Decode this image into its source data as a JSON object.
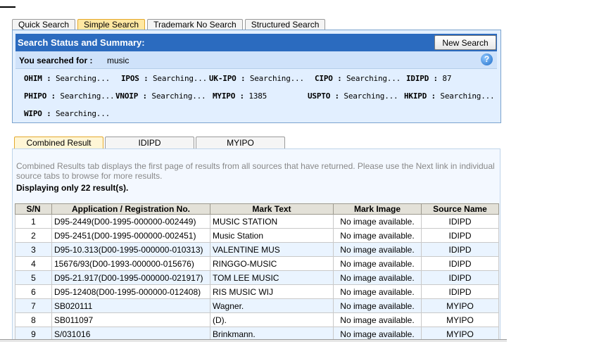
{
  "top_tabs": [
    {
      "label": "Quick Search"
    },
    {
      "label": "Simple Search"
    },
    {
      "label": "Trademark No Search"
    },
    {
      "label": "Structured Search"
    }
  ],
  "status": {
    "title": "Search Status and Summary:",
    "new_search_label": "New Search",
    "searched_label": "You searched for :",
    "searched_value": "music",
    "help_glyph": "?",
    "sources": [
      {
        "name": "OHIM :",
        "value": "Searching..."
      },
      {
        "name": "IPOS :",
        "value": "Searching..."
      },
      {
        "name": "UK-IPO :",
        "value": "Searching..."
      },
      {
        "name": "CIPO :",
        "value": "Searching..."
      },
      {
        "name": "IDIPD :",
        "value": "87"
      },
      {
        "name": "PHIPO :",
        "value": "Searching..."
      },
      {
        "name": "VNOIP :",
        "value": "Searching..."
      },
      {
        "name": "MYIPO :",
        "value": "1385"
      },
      {
        "name": "USPTO :",
        "value": "Searching..."
      },
      {
        "name": "HKIPD :",
        "value": "Searching..."
      },
      {
        "name": "WIPO :",
        "value": "Searching..."
      }
    ]
  },
  "result_tabs": [
    {
      "label": "Combined Result"
    },
    {
      "label": "IDIPD"
    },
    {
      "label": "MYIPO"
    }
  ],
  "results": {
    "info": "Combined Results tab displays the first page of results from all sources that have returned. Please use the Next link in individual source tabs to browse for more results.",
    "count": "Displaying only 22 result(s).",
    "columns": [
      "S/N",
      "Application / Registration No.",
      "Mark Text",
      "Mark Image",
      "Source Name"
    ],
    "rows": [
      {
        "sn": "1",
        "app": "D95-2449(D00-1995-000000-002449)",
        "mark": "MUSIC STATION",
        "image": "No image available.",
        "source": "IDIPD"
      },
      {
        "sn": "2",
        "app": "D95-2451(D00-1995-000000-002451)",
        "mark": "Music Station",
        "image": "No image available.",
        "source": "IDIPD"
      },
      {
        "sn": "3",
        "app": "D95-10.313(D00-1995-000000-010313)",
        "mark": "VALENTINE MUS",
        "image": "No image available.",
        "source": "IDIPD"
      },
      {
        "sn": "4",
        "app": "15676/93(D00-1993-000000-015676)",
        "mark": "RINGGO-MUSIC",
        "image": "No image available.",
        "source": "IDIPD"
      },
      {
        "sn": "5",
        "app": "D95-21.917(D00-1995-000000-021917)",
        "mark": "TOM LEE MUSIC",
        "image": "No image available.",
        "source": "IDIPD"
      },
      {
        "sn": "6",
        "app": "D95-12408(D00-1995-000000-012408)",
        "mark": "RIS MUSIC WIJ",
        "image": "No image available.",
        "source": "IDIPD"
      },
      {
        "sn": "7",
        "app": "SB020111",
        "mark": "Wagner.",
        "image": "No image available.",
        "source": "MYIPO"
      },
      {
        "sn": "8",
        "app": "SB011097",
        "mark": "(D).",
        "image": "No image available.",
        "source": "MYIPO"
      },
      {
        "sn": "9",
        "app": "S/031016",
        "mark": "Brinkmann.",
        "image": "No image available.",
        "source": "MYIPO"
      }
    ]
  }
}
